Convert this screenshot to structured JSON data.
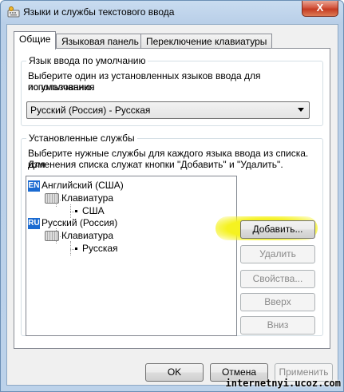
{
  "window": {
    "title": "Языки и службы текстового ввода",
    "close_label": "X"
  },
  "tabs": [
    {
      "label": "Общие",
      "active": true
    },
    {
      "label": "Языковая панель",
      "active": false
    },
    {
      "label": "Переключение клавиатуры",
      "active": false
    }
  ],
  "default_language": {
    "title": "Язык ввода по умолчанию",
    "description_line1": "Выберите один из установленных языков ввода для использования",
    "description_line2": "по умолчанию.",
    "selected": "Русский (Россия) - Русская"
  },
  "installed_services": {
    "title": "Установленные службы",
    "description_line1": "Выберите нужные службы для каждого языка ввода из списка. Для",
    "description_line2": "изменения списка служат кнопки \"Добавить\" и \"Удалить\".",
    "tree": [
      {
        "badge": "EN",
        "language": "Английский (США)",
        "category": "Клавиатура",
        "layout": "США"
      },
      {
        "badge": "RU",
        "language": "Русский (Россия)",
        "category": "Клавиатура",
        "layout": "Русская"
      }
    ],
    "buttons": {
      "add": "Добавить...",
      "remove": "Удалить",
      "properties": "Свойства...",
      "up": "Вверх",
      "down": "Вниз"
    }
  },
  "footer": {
    "ok": "OK",
    "cancel": "Отмена",
    "apply": "Применить"
  },
  "watermark": "internetnyi.ucoz.com",
  "colors": {
    "highlight": "#f5f220",
    "badge": "#1b6bd1",
    "close": "#c43b22"
  }
}
